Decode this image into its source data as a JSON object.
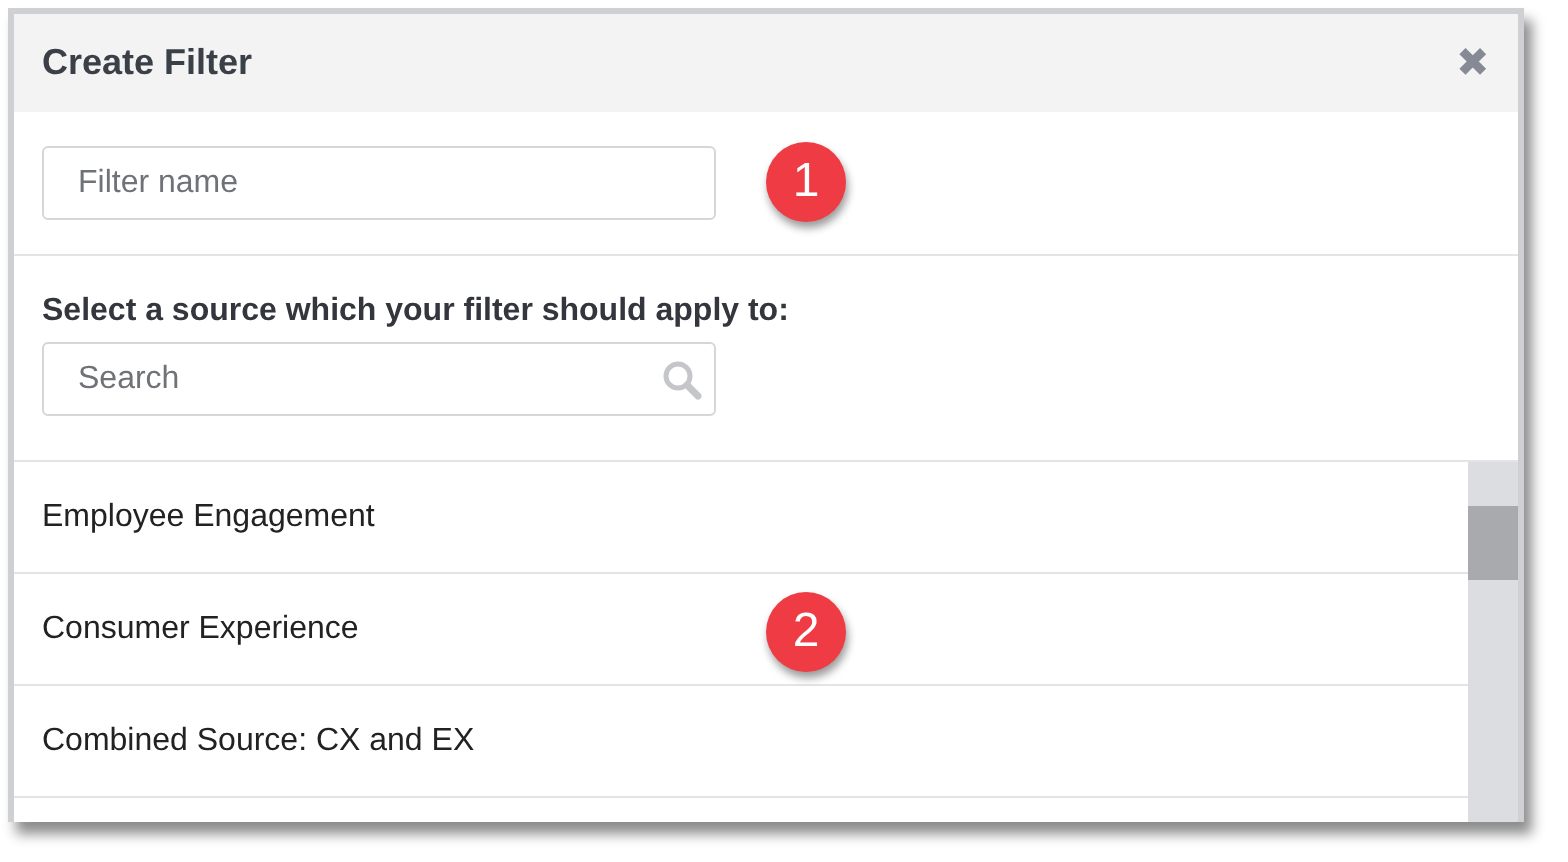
{
  "dialog": {
    "title": "Create Filter",
    "close_label": "✖"
  },
  "filter_name": {
    "placeholder": "Filter name"
  },
  "source_prompt": "Select a source which your filter should apply to:",
  "search": {
    "placeholder": "Search"
  },
  "sources": [
    {
      "label": "Employee Engagement"
    },
    {
      "label": "Consumer Experience"
    },
    {
      "label": "Combined Source: CX and EX"
    }
  ],
  "callouts": [
    "1",
    "2"
  ]
}
